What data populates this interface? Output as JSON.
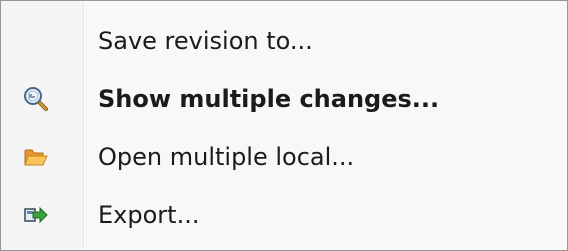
{
  "context_menu": {
    "items": [
      {
        "label": "Save revision to...",
        "icon": null,
        "default": false
      },
      {
        "label": "Show multiple changes...",
        "icon": "magnifier-icon",
        "default": true
      },
      {
        "label": "Open multiple local...",
        "icon": "folder-open-icon",
        "default": false
      },
      {
        "label": "Export...",
        "icon": "export-icon",
        "default": false
      }
    ]
  }
}
